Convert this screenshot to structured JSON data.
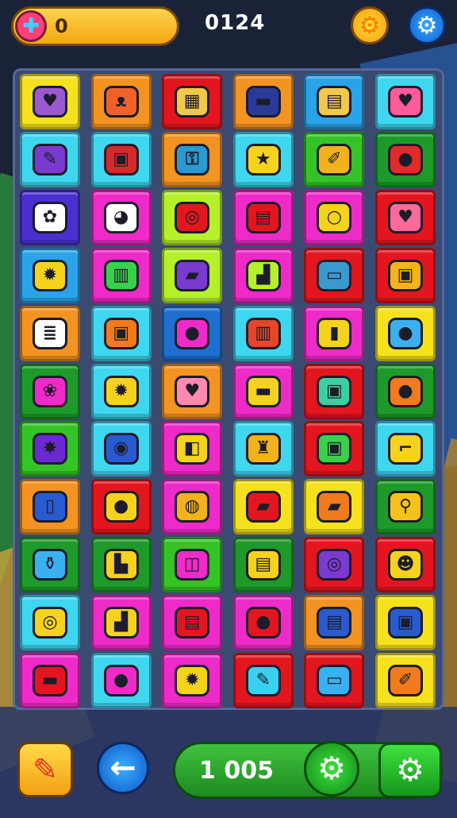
{
  "top_bar": {
    "coin_value": "0",
    "score": "0124",
    "coin_icon": "puzzle-icon",
    "settings_gold_icon": "gear-icon",
    "settings_blue_icon": "gear-icon"
  },
  "bottom_bar": {
    "value": "1 005",
    "pencil_icon": "pencil-icon",
    "back_icon": "arrow-left-icon",
    "gear_icon": "gear-icon",
    "settings_icon": "gear-icon"
  },
  "board": {
    "columns": 6,
    "rows": 11,
    "tiles": [
      {
        "color": "#f5e21c",
        "icon": "heart-gem-icon",
        "glyph": "♥",
        "gcolor": "#9b59d0"
      },
      {
        "color": "#f39321",
        "icon": "cat-face-icon",
        "glyph": "ᴥ",
        "gcolor": "#f0612a"
      },
      {
        "color": "#e3161f",
        "icon": "map-icon",
        "glyph": "▦",
        "gcolor": "#f2c84a"
      },
      {
        "color": "#f39321",
        "icon": "flag-icon",
        "glyph": "▬",
        "gcolor": "#2a3a9a"
      },
      {
        "color": "#2aa3e8",
        "icon": "chart-board-icon",
        "glyph": "▤",
        "gcolor": "#f2c84a"
      },
      {
        "color": "#3fd6f0",
        "icon": "heart-icon",
        "glyph": "♥",
        "gcolor": "#ff5a9a"
      },
      {
        "color": "#3fd6f0",
        "icon": "pencil-icon",
        "glyph": "✎",
        "gcolor": "#7a3ad0"
      },
      {
        "color": "#3fd6f0",
        "icon": "gift-box-icon",
        "glyph": "▣",
        "gcolor": "#d62a2a"
      },
      {
        "color": "#f39321",
        "icon": "key-icon",
        "glyph": "⚿",
        "gcolor": "#2a9ad0"
      },
      {
        "color": "#3fd6f0",
        "icon": "star-pen-icon",
        "glyph": "★",
        "gcolor": "#f5d21c"
      },
      {
        "color": "#35c427",
        "icon": "paint-brush-icon",
        "glyph": "✐",
        "gcolor": "#f2b21c"
      },
      {
        "color": "#1e9a2a",
        "icon": "balloon-icon",
        "glyph": "●",
        "gcolor": "#e32a2a"
      },
      {
        "color": "#4a2fd0",
        "icon": "flower-icon",
        "glyph": "✿",
        "gcolor": "#ffffff"
      },
      {
        "color": "#ee2bc8",
        "icon": "rabbit-icon",
        "glyph": "◕",
        "gcolor": "#ffffff"
      },
      {
        "color": "#b6f02a",
        "icon": "donut-icon",
        "glyph": "◎",
        "gcolor": "#e3161f"
      },
      {
        "color": "#ee2bc8",
        "icon": "flag-usa-icon",
        "glyph": "▤",
        "gcolor": "#e3161f"
      },
      {
        "color": "#ee2bc8",
        "icon": "rings-icon",
        "glyph": "○",
        "gcolor": "#f5d21c"
      },
      {
        "color": "#e3161f",
        "icon": "speech-heart-icon",
        "glyph": "♥",
        "gcolor": "#ff6a9a"
      },
      {
        "color": "#2aa3e8",
        "icon": "sun-gear-icon",
        "glyph": "✹",
        "gcolor": "#f5d21c"
      },
      {
        "color": "#ee2bc8",
        "icon": "cash-stack-icon",
        "glyph": "▥",
        "gcolor": "#3ad04a"
      },
      {
        "color": "#b6f02a",
        "icon": "book-icon",
        "glyph": "▰",
        "gcolor": "#7a3ad0"
      },
      {
        "color": "#ee2bc8",
        "icon": "bucket-icon",
        "glyph": "▟",
        "gcolor": "#b6f02a"
      },
      {
        "color": "#e3161f",
        "icon": "tablet-icon",
        "glyph": "▭",
        "gcolor": "#3a9ad0"
      },
      {
        "color": "#e3161f",
        "icon": "briefcase-icon",
        "glyph": "▣",
        "gcolor": "#f5b21c"
      },
      {
        "color": "#f39321",
        "icon": "book-stack-icon",
        "glyph": "≣",
        "gcolor": "#ffffff"
      },
      {
        "color": "#3fd6f0",
        "icon": "suitcase-icon",
        "glyph": "▣",
        "gcolor": "#f07a1c"
      },
      {
        "color": "#1e6fd0",
        "icon": "blob-icon",
        "glyph": "●",
        "gcolor": "#ee2bc8"
      },
      {
        "color": "#3fd6f0",
        "icon": "chest-icon",
        "glyph": "▥",
        "gcolor": "#e3462a"
      },
      {
        "color": "#ee2bc8",
        "icon": "battery-icon",
        "glyph": "▮",
        "gcolor": "#f5d21c"
      },
      {
        "color": "#f5e21c",
        "icon": "chat-bubble-icon",
        "glyph": "●",
        "gcolor": "#3ab0f0"
      },
      {
        "color": "#1e9a2a",
        "icon": "flowers-icon",
        "glyph": "❀",
        "gcolor": "#ee2bc8"
      },
      {
        "color": "#3fd6f0",
        "icon": "gear-sun-icon",
        "glyph": "✹",
        "gcolor": "#f5d21c"
      },
      {
        "color": "#f39321",
        "icon": "heart-pair-icon",
        "glyph": "♥",
        "gcolor": "#ff8ab0"
      },
      {
        "color": "#ee2bc8",
        "icon": "capsule-icon",
        "glyph": "▬",
        "gcolor": "#f5d21c"
      },
      {
        "color": "#e3161f",
        "icon": "picture-frame-icon",
        "glyph": "▣",
        "gcolor": "#3ad0a0"
      },
      {
        "color": "#1e9a2a",
        "icon": "monster-icon",
        "glyph": "●",
        "gcolor": "#f07a1c"
      },
      {
        "color": "#35c427",
        "icon": "spiky-ball-icon",
        "glyph": "✸",
        "gcolor": "#6a2ad0"
      },
      {
        "color": "#3fd6f0",
        "icon": "buttons-icon",
        "glyph": "◉",
        "gcolor": "#2a5ad0"
      },
      {
        "color": "#ee2bc8",
        "icon": "cube-icon",
        "glyph": "◧",
        "gcolor": "#f5d21c"
      },
      {
        "color": "#3fd6f0",
        "icon": "trophy-icon",
        "glyph": "♜",
        "gcolor": "#f2b21c"
      },
      {
        "color": "#e3161f",
        "icon": "card-icon",
        "glyph": "▣",
        "gcolor": "#3ad04a"
      },
      {
        "color": "#3fd6f0",
        "icon": "pipe-icon",
        "glyph": "⌐",
        "gcolor": "#f5d21c"
      },
      {
        "color": "#f39321",
        "icon": "phone-icon",
        "glyph": "▯",
        "gcolor": "#2a5ad0"
      },
      {
        "color": "#e3161f",
        "icon": "fruit-icon",
        "glyph": "●",
        "gcolor": "#f5d21c"
      },
      {
        "color": "#ee2bc8",
        "icon": "ball-icon",
        "glyph": "◍",
        "gcolor": "#f2b21c"
      },
      {
        "color": "#f5e21c",
        "icon": "note-icon",
        "glyph": "▰",
        "gcolor": "#e3161f"
      },
      {
        "color": "#f5e21c",
        "icon": "eraser-icon",
        "glyph": "▰",
        "gcolor": "#f07a1c"
      },
      {
        "color": "#1e9a2a",
        "icon": "rattle-icon",
        "glyph": "⚲",
        "gcolor": "#f5c21c"
      },
      {
        "color": "#1e9a2a",
        "icon": "bottle-icon",
        "glyph": "⚱",
        "gcolor": "#3ab0f0"
      },
      {
        "color": "#1e9a2a",
        "icon": "lamp-icon",
        "glyph": "▙",
        "gcolor": "#f5d21c"
      },
      {
        "color": "#35c427",
        "icon": "roll-icon",
        "glyph": "◫",
        "gcolor": "#ee2bc8"
      },
      {
        "color": "#1e9a2a",
        "icon": "radio-icon",
        "glyph": "▤",
        "gcolor": "#f5d21c"
      },
      {
        "color": "#e3161f",
        "icon": "padlock-icon",
        "glyph": "◎",
        "gcolor": "#7a3ad0"
      },
      {
        "color": "#e3161f",
        "icon": "smiley-bubble-icon",
        "glyph": "☻",
        "gcolor": "#f5d21c"
      },
      {
        "color": "#3fd6f0",
        "icon": "compass-icon",
        "glyph": "◎",
        "gcolor": "#f5d21c"
      },
      {
        "color": "#ee2bc8",
        "icon": "shoe-icon",
        "glyph": "▟",
        "gcolor": "#f5d21c"
      },
      {
        "color": "#ee2bc8",
        "icon": "flag-usa-icon",
        "glyph": "▤",
        "gcolor": "#e3161f"
      },
      {
        "color": "#ee2bc8",
        "icon": "toy-icon",
        "glyph": "●",
        "gcolor": "#e3161f"
      },
      {
        "color": "#f39321",
        "icon": "flag-usa-icon",
        "glyph": "▤",
        "gcolor": "#2a5ad0"
      },
      {
        "color": "#f5e21c",
        "icon": "camera-icon",
        "glyph": "▣",
        "gcolor": "#2a5ad0"
      },
      {
        "color": "#ee2bc8",
        "icon": "flag-icon",
        "glyph": "▬",
        "gcolor": "#e3161f"
      },
      {
        "color": "#3fd6f0",
        "icon": "radish-face-icon",
        "glyph": "●",
        "gcolor": "#ee2bc8"
      },
      {
        "color": "#ee2bc8",
        "icon": "sun-face-icon",
        "glyph": "✹",
        "gcolor": "#f5d21c"
      },
      {
        "color": "#e3161f",
        "icon": "marker-icon",
        "glyph": "✎",
        "gcolor": "#3ad0f0"
      },
      {
        "color": "#e3161f",
        "icon": "cassette-icon",
        "glyph": "▭",
        "gcolor": "#3ab0f0"
      },
      {
        "color": "#f5e21c",
        "icon": "brush-icon",
        "glyph": "✐",
        "gcolor": "#f07a1c"
      }
    ]
  }
}
